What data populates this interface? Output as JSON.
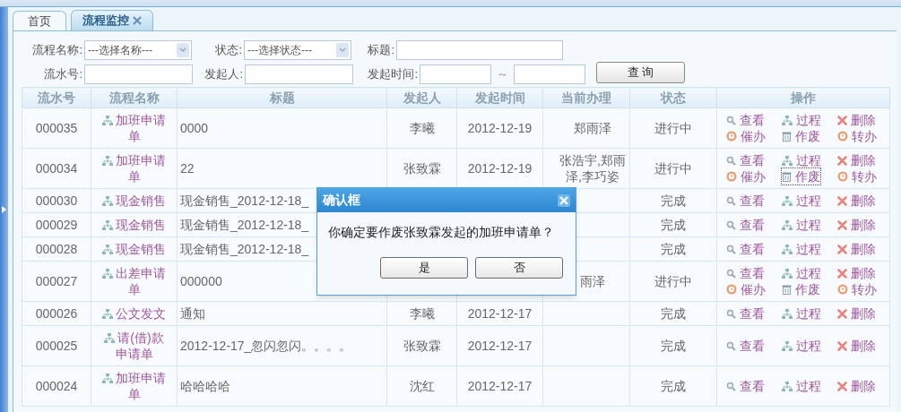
{
  "tabs": [
    {
      "label": "首页",
      "selected": false,
      "closable": false
    },
    {
      "label": "流程监控",
      "selected": true,
      "closable": true
    }
  ],
  "filters": [
    [
      {
        "kind": "select",
        "label": "流程名称:",
        "value": "---选择名称---"
      },
      {
        "kind": "select",
        "label": "状态:",
        "value": "---选择状态---"
      },
      {
        "kind": "text",
        "label": "标题:"
      }
    ],
    [
      {
        "kind": "text",
        "label": "流水号:"
      },
      {
        "kind": "text",
        "label": "发起人:"
      },
      {
        "kind": "range",
        "label": "发起时间:",
        "separator": "～"
      }
    ]
  ],
  "search_button": "查 询",
  "table": {
    "columns": [
      "流水号",
      "流程名称",
      "标题",
      "发起人",
      "发起时间",
      "当前办理",
      "状态",
      "操作"
    ],
    "rows": [
      {
        "no": "000035",
        "flow": "加班申请单",
        "title": "0000",
        "initiator": "李曦",
        "date": "2012-12-19",
        "handler": "郑雨泽",
        "status": "进行中",
        "actions": [
          {
            "kind": "view",
            "label": "查看",
            "focused": false
          },
          {
            "kind": "process",
            "label": "过程",
            "focused": false
          },
          {
            "kind": "delete",
            "label": "删除",
            "focused": false
          },
          {
            "kind": "urge",
            "label": "催办",
            "focused": false
          },
          {
            "kind": "void",
            "label": "作废",
            "focused": false
          },
          {
            "kind": "transfer",
            "label": "转办",
            "focused": false
          }
        ]
      },
      {
        "no": "000034",
        "flow": "加班申请单",
        "title": "22",
        "initiator": "张致霖",
        "date": "2012-12-19",
        "handler": "张浩宇,郑雨泽,李巧姿",
        "status": "进行中",
        "actions": [
          {
            "kind": "view",
            "label": "查看",
            "focused": false
          },
          {
            "kind": "process",
            "label": "过程",
            "focused": false
          },
          {
            "kind": "delete",
            "label": "删除",
            "focused": false
          },
          {
            "kind": "urge",
            "label": "催办",
            "focused": false
          },
          {
            "kind": "void",
            "label": "作废",
            "focused": true
          },
          {
            "kind": "transfer",
            "label": "转办",
            "focused": false
          }
        ]
      },
      {
        "no": "000030",
        "flow": "现金销售",
        "title": "现金销售_2012-12-18_",
        "status": "完成",
        "actions": [
          {
            "kind": "view",
            "label": "查看",
            "focused": false
          },
          {
            "kind": "process",
            "label": "过程",
            "focused": false
          },
          {
            "kind": "delete",
            "label": "删除",
            "focused": false
          }
        ]
      },
      {
        "no": "000029",
        "flow": "现金销售",
        "title": "现金销售_2012-12-18_",
        "status": "完成",
        "actions": [
          {
            "kind": "view",
            "label": "查看",
            "focused": false
          },
          {
            "kind": "process",
            "label": "过程",
            "focused": false
          },
          {
            "kind": "delete",
            "label": "删除",
            "focused": false
          }
        ]
      },
      {
        "no": "000028",
        "flow": "现金销售",
        "title": "现金销售_2012-12-18_",
        "status": "完成",
        "actions": [
          {
            "kind": "view",
            "label": "查看",
            "focused": false
          },
          {
            "kind": "process",
            "label": "过程",
            "focused": false
          },
          {
            "kind": "delete",
            "label": "删除",
            "focused": false
          }
        ]
      },
      {
        "no": "000027",
        "flow": "出差申请单",
        "title": "000000",
        "handler": "雨泽",
        "status": "进行中",
        "actions": [
          {
            "kind": "view",
            "label": "查看",
            "focused": false
          },
          {
            "kind": "process",
            "label": "过程",
            "focused": false
          },
          {
            "kind": "delete",
            "label": "删除",
            "focused": false
          },
          {
            "kind": "urge",
            "label": "催办",
            "focused": false
          },
          {
            "kind": "void",
            "label": "作废",
            "focused": false
          },
          {
            "kind": "transfer",
            "label": "转办",
            "focused": false
          }
        ]
      },
      {
        "no": "000026",
        "flow": "公文发文",
        "title": "通知",
        "initiator": "李曦",
        "date": "2012-12-17",
        "status": "完成",
        "actions": [
          {
            "kind": "view",
            "label": "查看",
            "focused": false
          },
          {
            "kind": "process",
            "label": "过程",
            "focused": false
          },
          {
            "kind": "delete",
            "label": "删除",
            "focused": false
          }
        ]
      },
      {
        "no": "000025",
        "flow": "请(借)款申请单",
        "title": "2012-12-17_忽闪忽闪。。。。",
        "initiator": "张致霖",
        "date": "2012-12-17",
        "status": "完成",
        "actions": [
          {
            "kind": "view",
            "label": "查看",
            "focused": false
          },
          {
            "kind": "process",
            "label": "过程",
            "focused": false
          },
          {
            "kind": "delete",
            "label": "删除",
            "focused": false
          }
        ]
      },
      {
        "no": "000024",
        "flow": "加班申请单",
        "title": "哈哈哈哈",
        "initiator": "沈红",
        "date": "2012-12-17",
        "status": "完成",
        "actions": [
          {
            "kind": "view",
            "label": "查看",
            "focused": false
          },
          {
            "kind": "process",
            "label": "过程",
            "focused": false
          },
          {
            "kind": "delete",
            "label": "删除",
            "focused": false
          }
        ]
      }
    ]
  },
  "dialog": {
    "title": "确认框",
    "message": "你确定要作废张致霖发起的加班申请单？",
    "buttons": [
      "是",
      "否"
    ]
  }
}
